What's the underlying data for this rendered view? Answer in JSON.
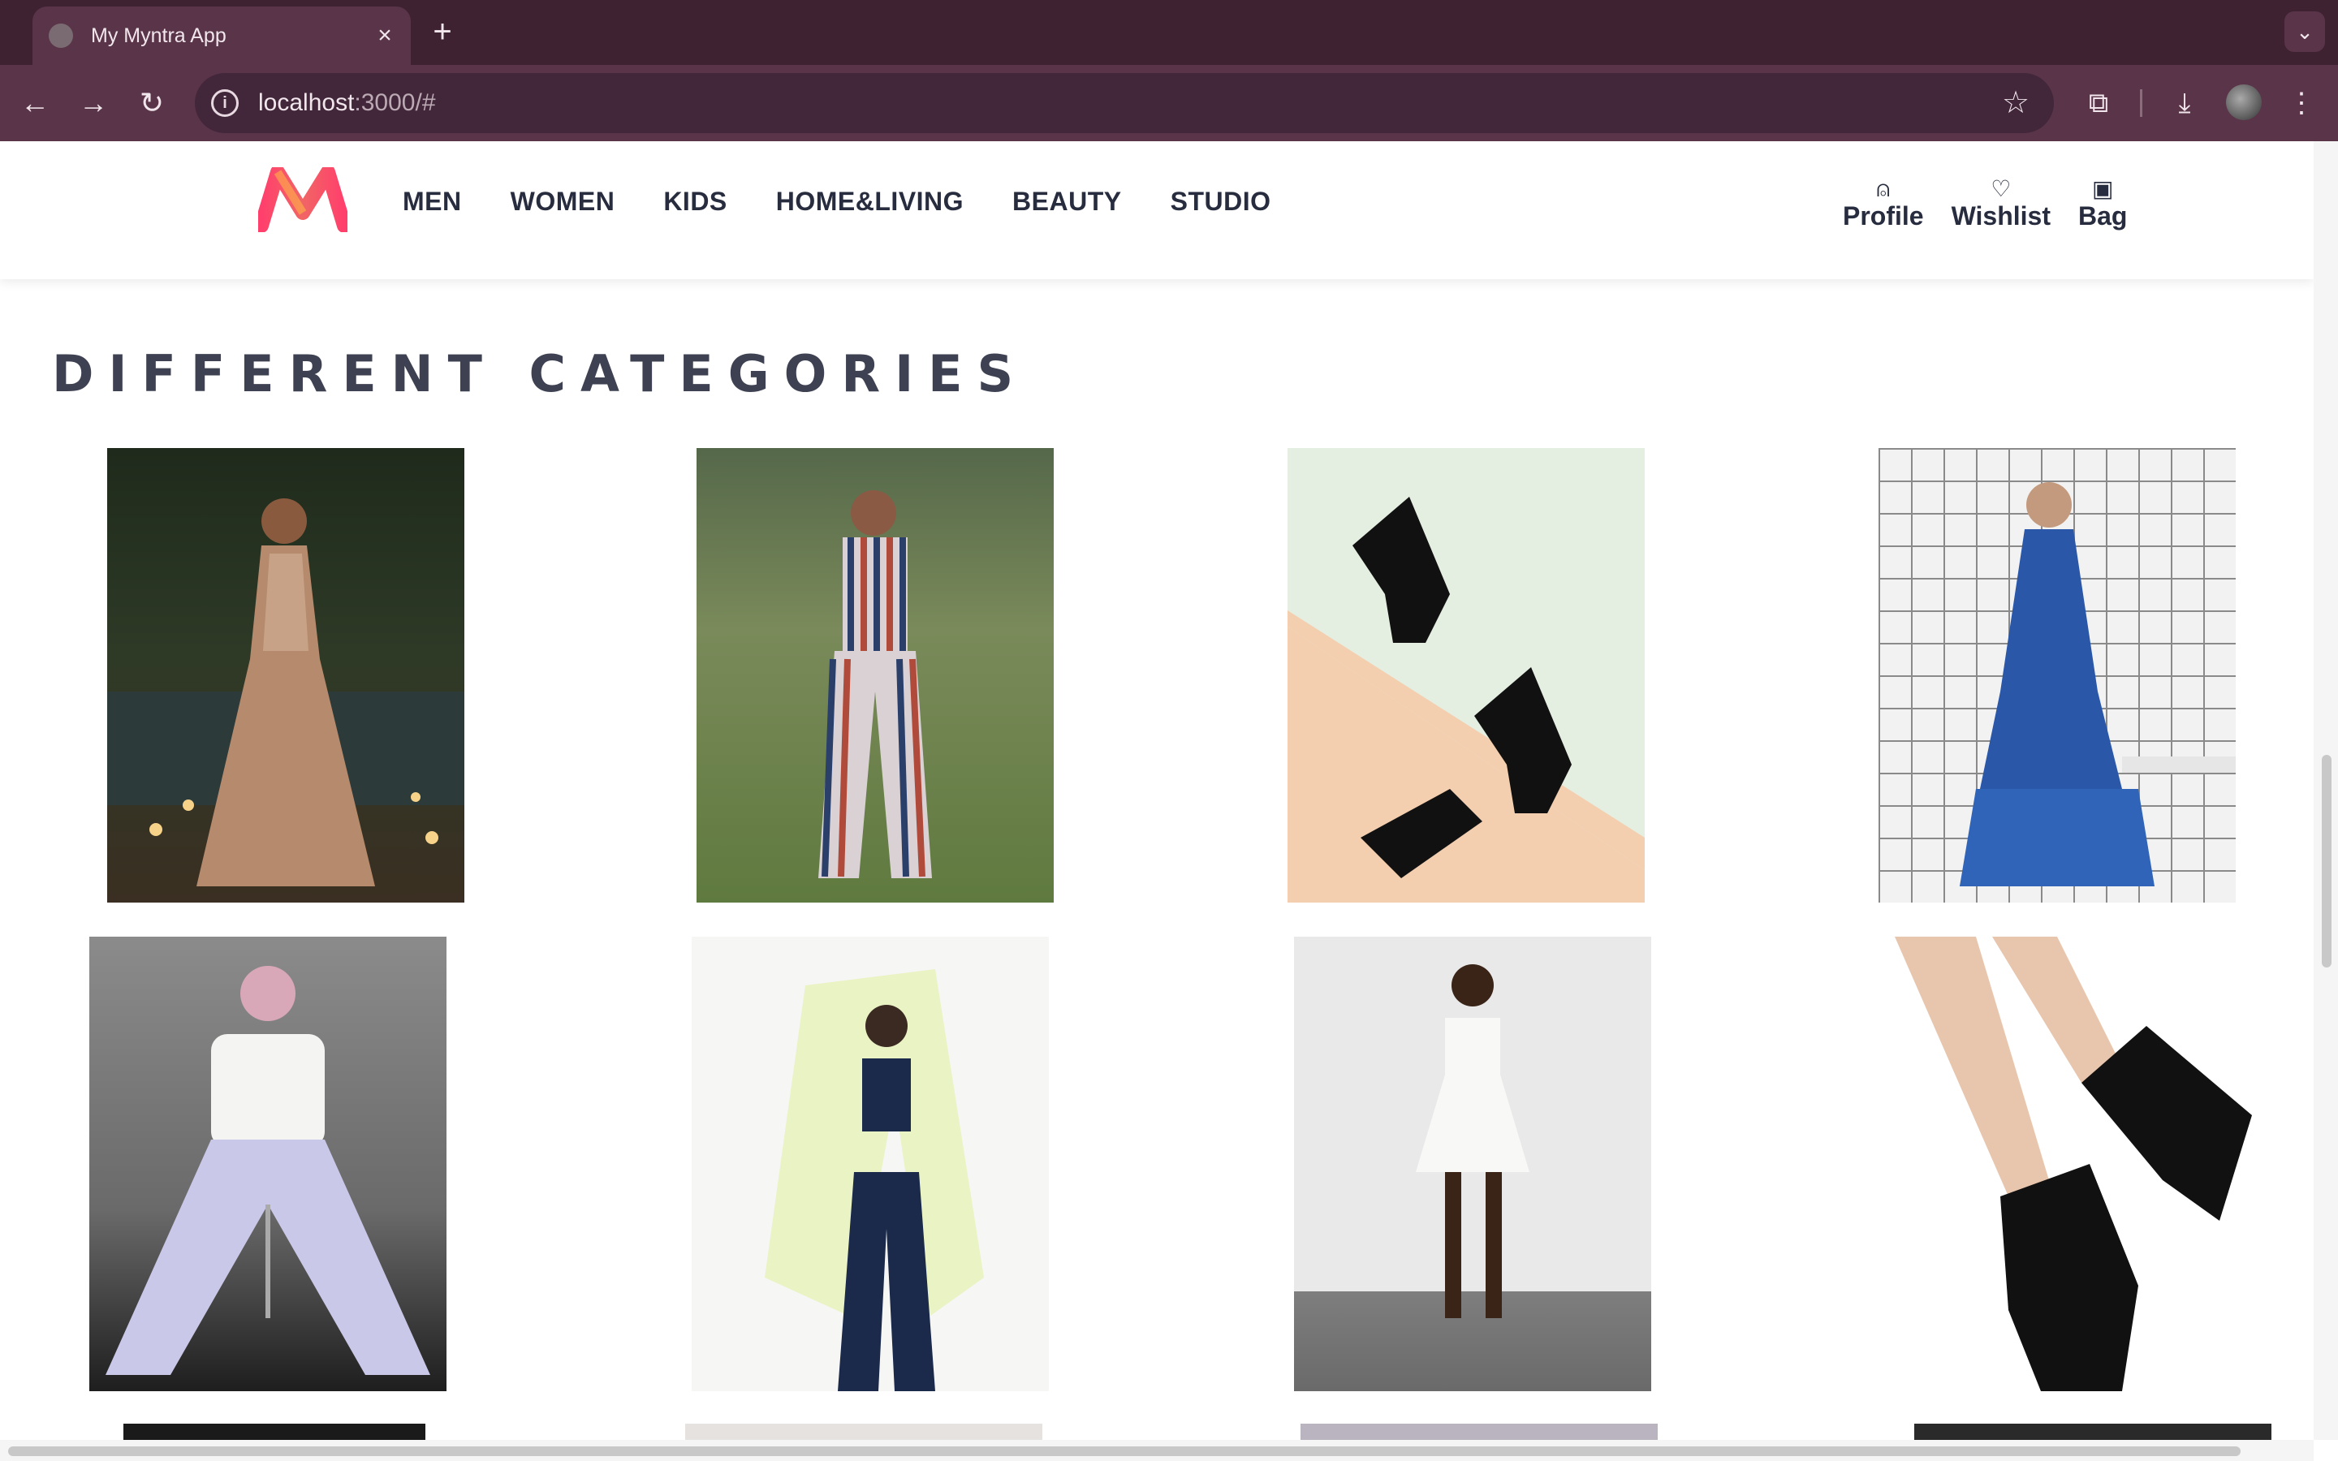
{
  "browser": {
    "tab_title": "My Myntra App",
    "url_host": "localhost",
    "url_rest": ":3000/#"
  },
  "header": {
    "nav": [
      "MEN",
      "WOMEN",
      "KIDS",
      "HOME&LIVING",
      "BEAUTY",
      "STUDIO"
    ],
    "actions": {
      "profile": "Profile",
      "wishlist": "Wishlist",
      "bag": "Bag"
    }
  },
  "section_title": "DIFFERENT CATEGORIES",
  "tiles": [
    {
      "icon": "lehenga-model-image"
    },
    {
      "icon": "striped-jumpsuit-image"
    },
    {
      "icon": "block-heel-sandals-image"
    },
    {
      "icon": "blue-tiered-dress-image"
    },
    {
      "icon": "white-top-jeans-image"
    },
    {
      "icon": "sports-jacket-image"
    },
    {
      "icon": "white-dress-image"
    },
    {
      "icon": "platform-heels-image"
    }
  ],
  "colors": {
    "brand_pink": "#ff3f6c",
    "brand_orange": "#f16565",
    "text_dark": "#282c3f"
  }
}
